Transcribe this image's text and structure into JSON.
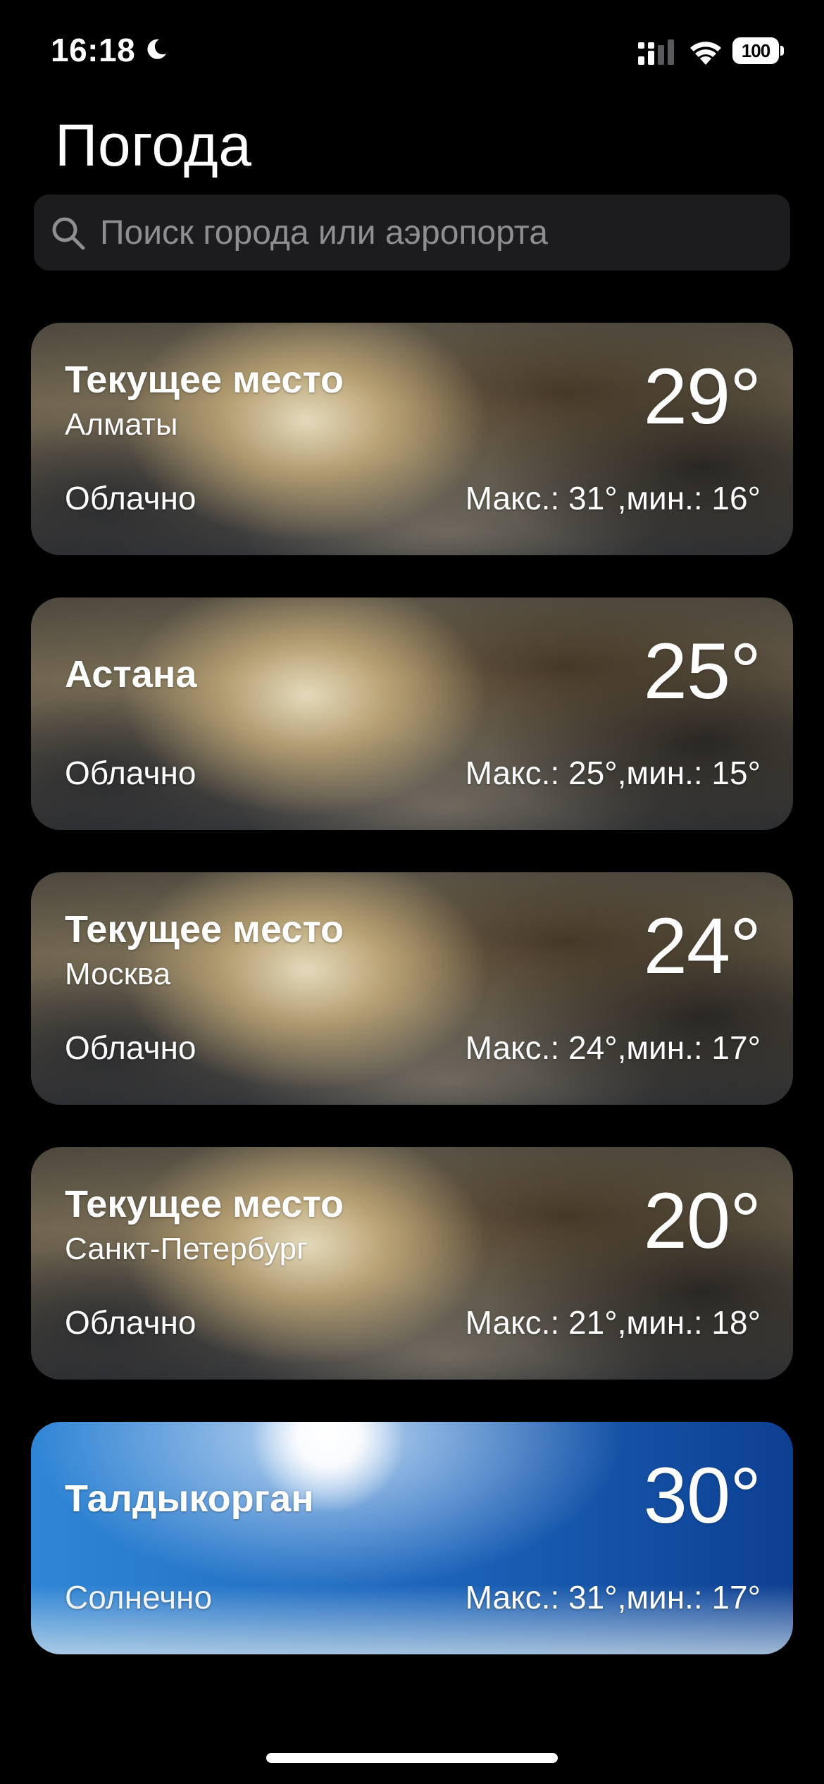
{
  "status_bar": {
    "time": "16:18",
    "focus_icon": "moon-icon",
    "signal_icon": "cellular-signal-icon",
    "wifi_icon": "wifi-icon",
    "battery_level": "100"
  },
  "header": {
    "title": "Погода"
  },
  "search": {
    "icon": "search-icon",
    "placeholder": "Поиск города или аэропорта"
  },
  "locations": [
    {
      "title": "Текущее место",
      "subtitle": "Алматы",
      "temperature": "29°",
      "condition": "Облачно",
      "range": "Макс.: 31°,мин.: 16°",
      "background": "cloudy"
    },
    {
      "title": "Астана",
      "subtitle": "",
      "temperature": "25°",
      "condition": "Облачно",
      "range": "Макс.: 25°,мин.: 15°",
      "background": "cloudy"
    },
    {
      "title": "Текущее место",
      "subtitle": "Москва",
      "temperature": "24°",
      "condition": "Облачно",
      "range": "Макс.: 24°,мин.: 17°",
      "background": "cloudy"
    },
    {
      "title": "Текущее место",
      "subtitle": "Санкт-Петербург",
      "temperature": "20°",
      "condition": "Облачно",
      "range": "Макс.: 21°,мин.: 18°",
      "background": "cloudy"
    },
    {
      "title": "Талдыкорган",
      "subtitle": "",
      "temperature": "30°",
      "condition": "Солнечно",
      "range": "Макс.: 31°,мин.: 17°",
      "background": "sunny"
    }
  ],
  "colors": {
    "background": "#000000",
    "search_field": "#1c1c1e",
    "placeholder": "#8e8e93",
    "text": "#ffffff"
  }
}
